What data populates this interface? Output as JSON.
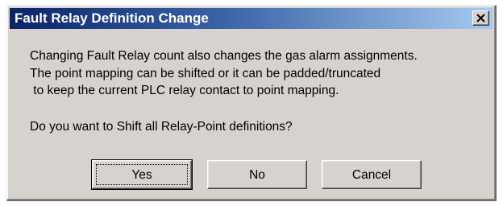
{
  "window": {
    "title": "Fault Relay Definition Change",
    "close_icon": "close-icon"
  },
  "message": {
    "lines": [
      "Changing Fault Relay count also changes the gas alarm assignments.",
      "The point mapping can be shifted or it can be padded/truncated",
      " to keep the current PLC relay contact to point mapping."
    ],
    "question": "Do you want to Shift all Relay-Point definitions?"
  },
  "buttons": {
    "yes": "Yes",
    "no": "No",
    "cancel": "Cancel"
  },
  "colors": {
    "titlebar_start": "#0a246a",
    "titlebar_end": "#a6caf0",
    "dialog_face": "#d6d3ce"
  }
}
